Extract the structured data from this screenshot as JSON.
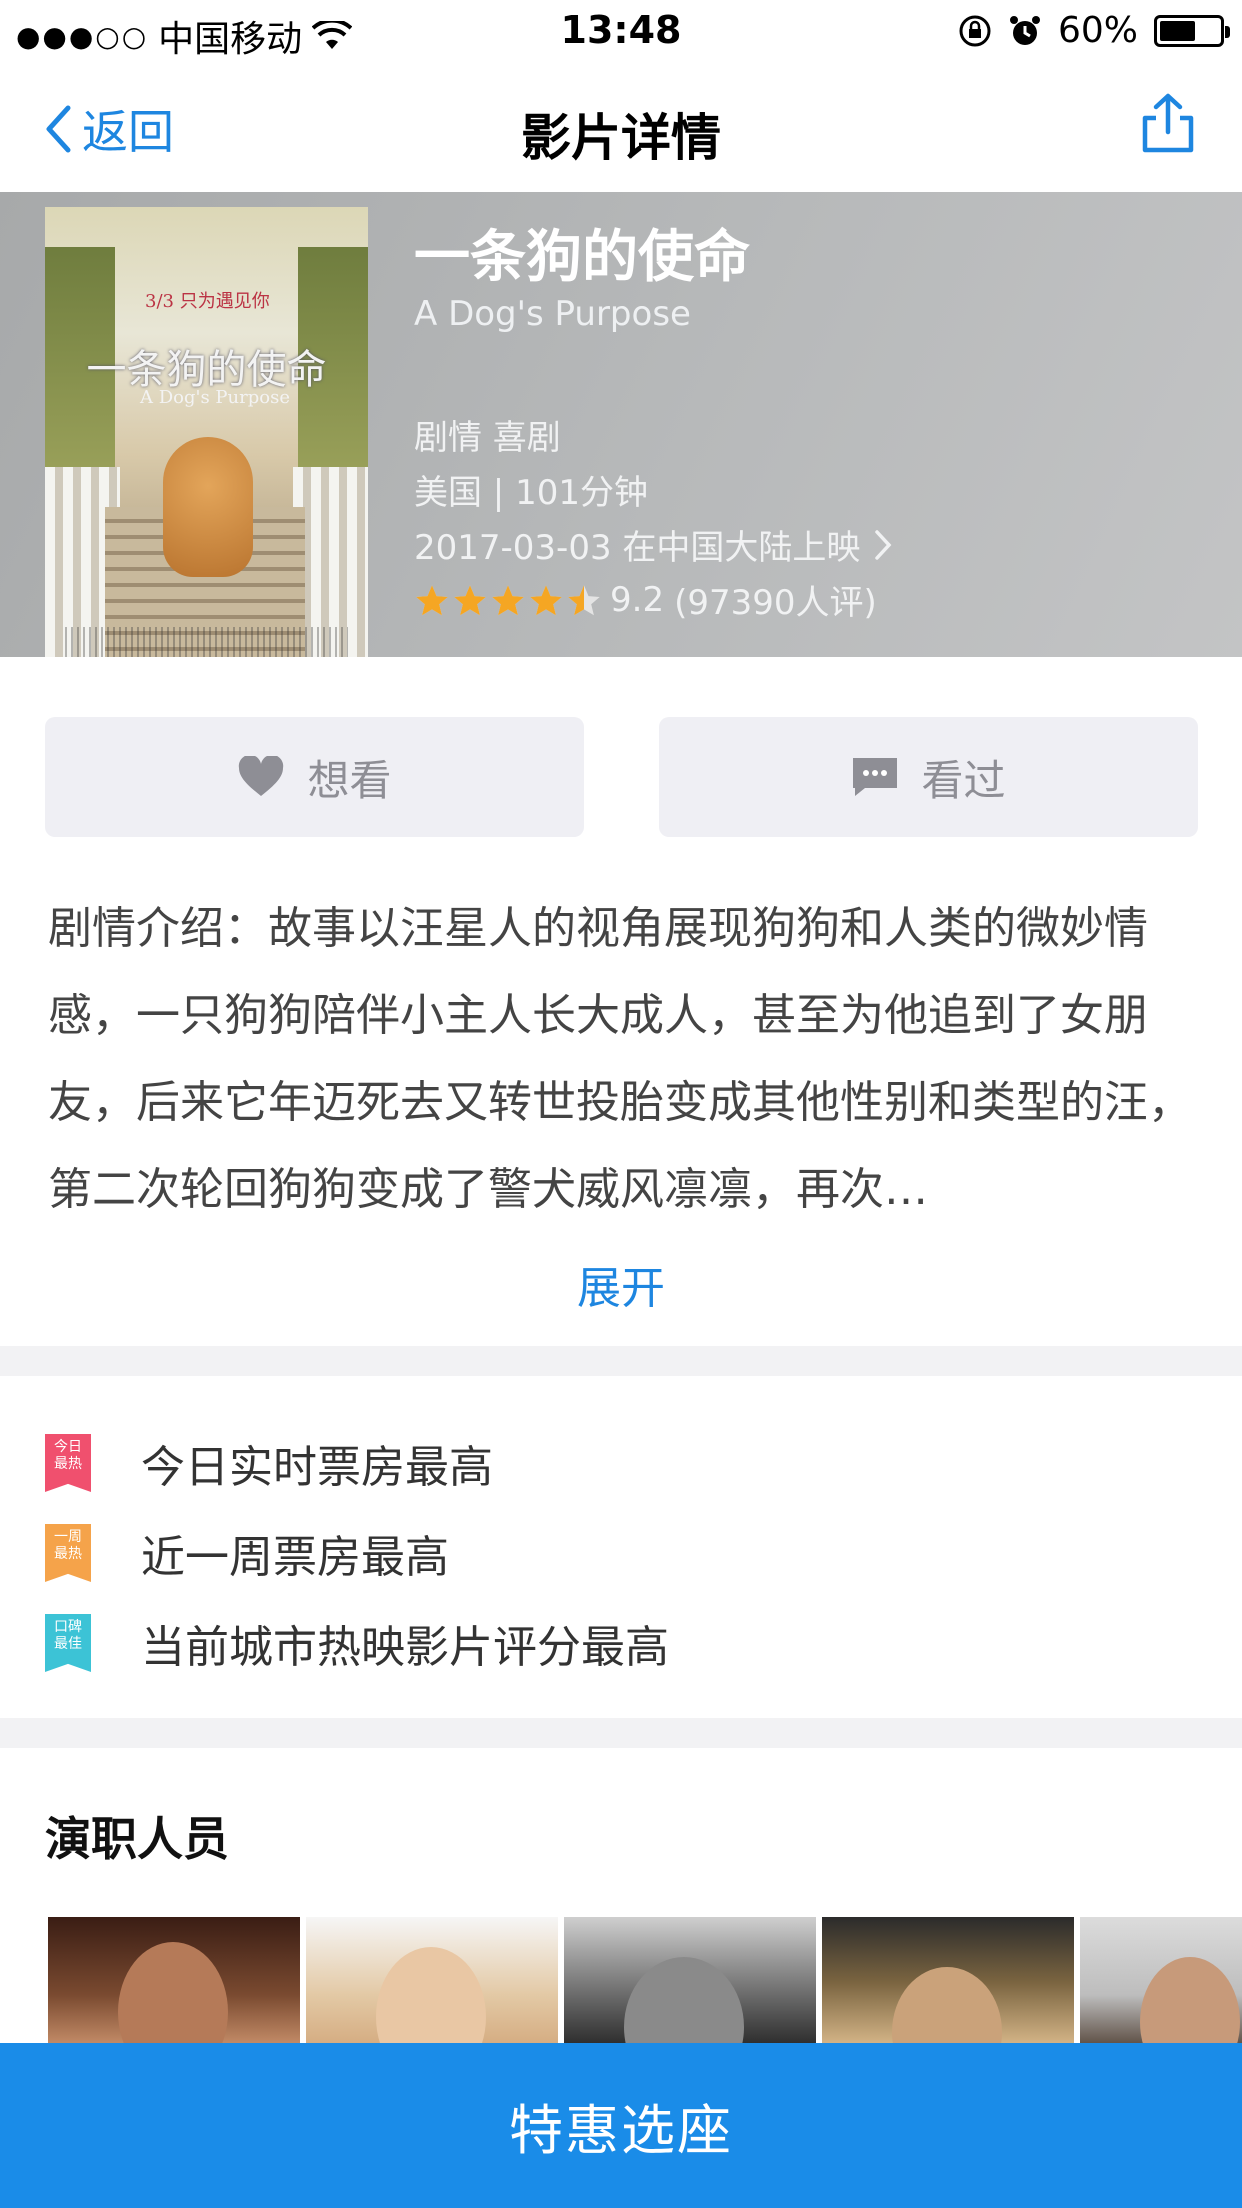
{
  "status_bar": {
    "signal_dots": "●●●○○",
    "carrier": "中国移动",
    "time": "13:48",
    "battery_percent": "60%",
    "battery_level": 0.6
  },
  "nav": {
    "back_label": "返回",
    "title": "影片详情"
  },
  "movie": {
    "title": "一条狗的使命",
    "title_en": "A Dog's Purpose",
    "genre": "剧情 喜剧",
    "meta": "美国 | 101分钟",
    "release": "2017-03-03 在中国大陆上映",
    "rating_score": "9.2",
    "rating_count": "(97390人评)",
    "stars": 4.5,
    "poster": {
      "title": "一条狗的使命",
      "subtitle": "A Dog's Purpose",
      "tagline": "3/3 只为遇见你"
    }
  },
  "actions": {
    "want_label": "想看",
    "seen_label": "看过"
  },
  "synopsis": {
    "text": "剧情介绍：故事以汪星人的视角展现狗狗和人类的微妙情感，一只狗狗陪伴小主人长大成人，甚至为他追到了女朋友，后来它年迈死去又转世投胎变成其他性别和类型的汪，第二次轮回狗狗变成了警犬威风凛凛，再次…",
    "expand_label": "展开"
  },
  "badges": [
    {
      "ribbon_line1": "今日",
      "ribbon_line2": "最热",
      "text": "今日实时票房最高",
      "color": "#f0506e"
    },
    {
      "ribbon_line1": "一周",
      "ribbon_line2": "最热",
      "text": "近一周票房最高",
      "color": "#f5a34a"
    },
    {
      "ribbon_line1": "口碑",
      "ribbon_line2": "最佳",
      "text": "当前城市热映影片评分最高",
      "color": "#3cc3d6"
    }
  ],
  "cast_section": {
    "title": "演职人员"
  },
  "book_button": {
    "label": "特惠选座"
  },
  "colors": {
    "accent": "#1e86e0",
    "book_button": "#1a8ce8",
    "star": "#f5a623"
  }
}
